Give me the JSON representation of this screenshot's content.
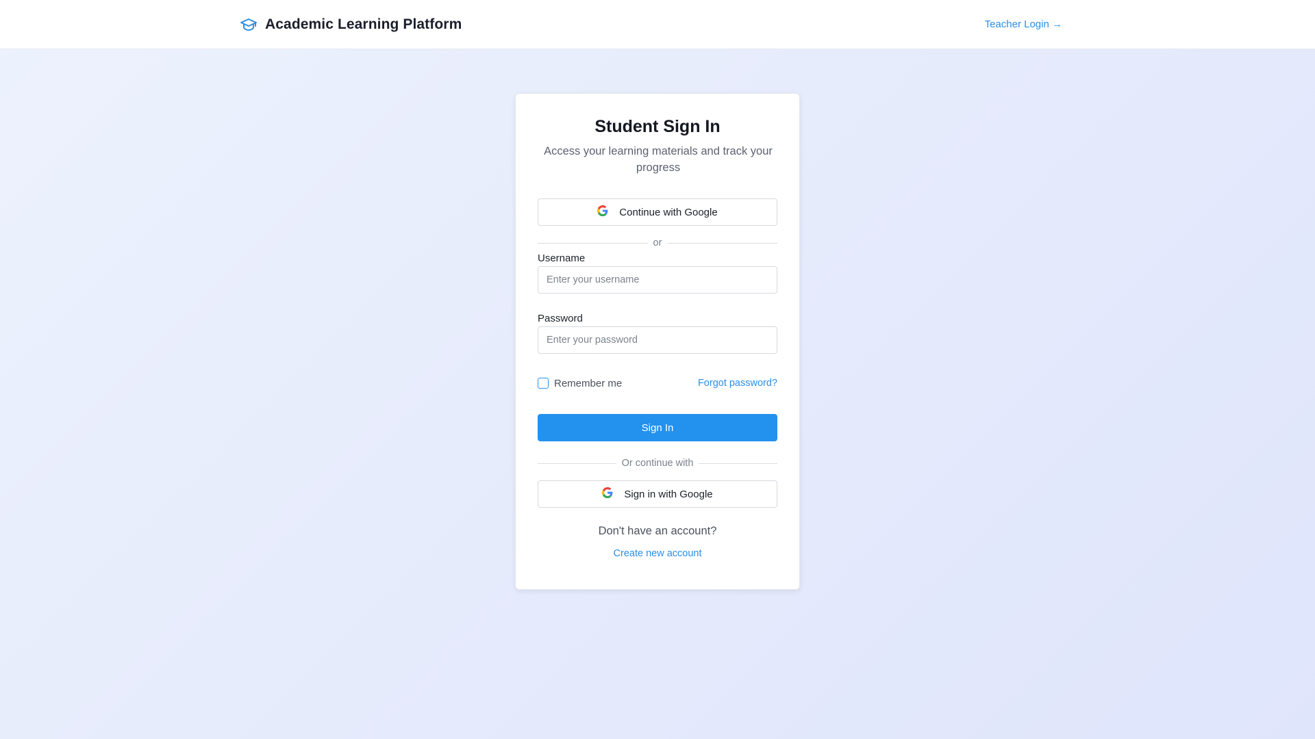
{
  "header": {
    "brand_icon": "graduation-cap-icon",
    "brand_title": "Academic Learning Platform",
    "teacher_link": "Teacher Login →"
  },
  "card": {
    "title": "Student Sign In",
    "subtitle": "Access your learning materials and track your progress",
    "google_top_button": "Continue with Google",
    "divider_or": "or",
    "username": {
      "label": "Username",
      "placeholder": "Enter your username",
      "value": ""
    },
    "password": {
      "label": "Password",
      "placeholder": "Enter your password",
      "value": ""
    },
    "remember_me": "Remember me",
    "remember_checked": false,
    "forgot_password": "Forgot password?",
    "sign_in_button": "Sign In",
    "divider_continue": "Or continue with",
    "google_bottom_button": "Sign in with Google",
    "no_account_text": "Don't have an account?",
    "create_account_link": "Create new account"
  },
  "colors": {
    "accent": "#2391ee",
    "link": "#2a8ee6",
    "title": "#141821",
    "muted": "#5b6270"
  }
}
